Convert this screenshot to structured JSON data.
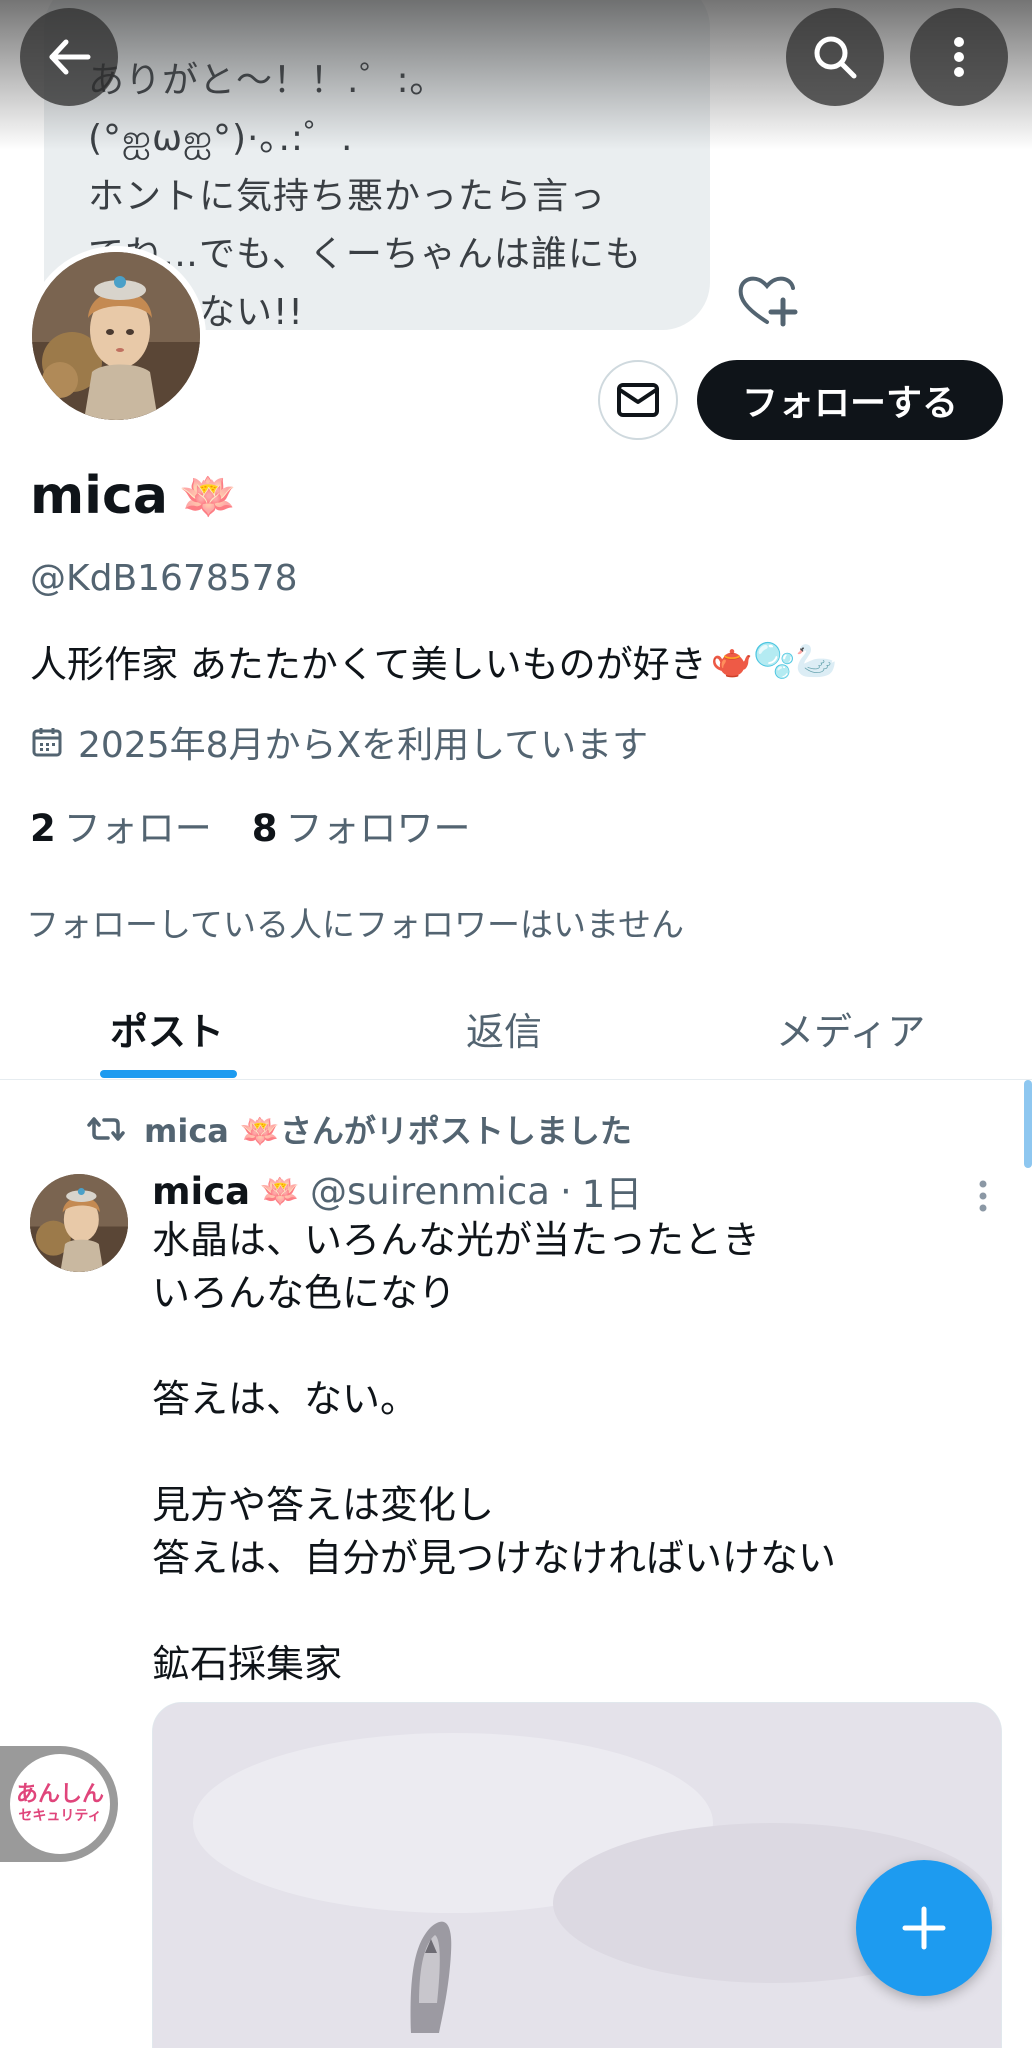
{
  "header": {
    "banner_text": "ありがと〜！！.゜:｡(°ஐωஐ°)·｡.:゜.\nホントに気持ち悪かったら言っ\nてね…でも、くーちゃんは誰にも\n　　　ない!!"
  },
  "profile": {
    "display_name": "mica",
    "name_emoji": "🪷",
    "handle": "@KdB1678578",
    "bio": "人形作家  あたたかくて美しいものが好き",
    "bio_emojis": "🫖🫧🦢",
    "joined": "2025年8月からXを利用しています",
    "following_count": "2",
    "following_label": "フォロー",
    "followers_count": "8",
    "followers_label": "フォロワー",
    "mutual_note": "フォローしている人にフォロワーはいません",
    "follow_button": "フォローする"
  },
  "tabs": [
    {
      "label": "ポスト",
      "active": true
    },
    {
      "label": "返信",
      "active": false
    },
    {
      "label": "メディア",
      "active": false
    }
  ],
  "post": {
    "repost_label": "mica 🪷さんがリポストしました",
    "author_name": "mica",
    "author_emoji": "🪷",
    "author_handle": "@suirenmica",
    "separator": "·",
    "age": "1日",
    "body": "水晶は、いろんな光が当たったとき\nいろんな色になり\n\n答えは、ない。\n\n見方や答えは変化し\n答えは、自分が見つけなければいけない\n\n鉱石採集家"
  },
  "security_badge": {
    "line1": "あんしん",
    "line2": "セキュリティ"
  },
  "colors": {
    "accent": "#1d9bf0",
    "text_primary": "#0f1419",
    "text_secondary": "#536471",
    "follow_button_bg": "#0f1419"
  }
}
